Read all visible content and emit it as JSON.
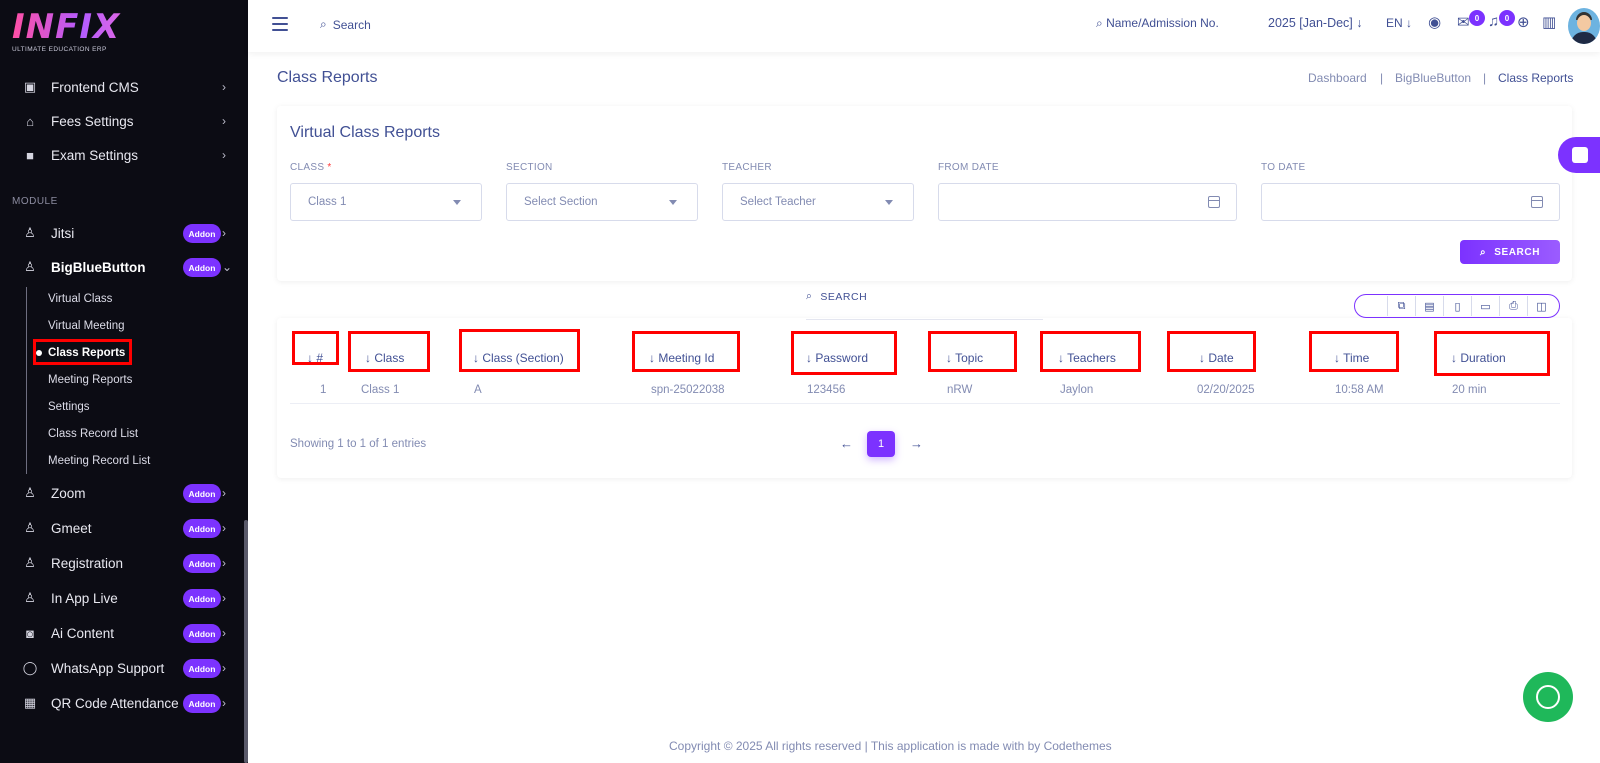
{
  "sidebar": {
    "logo": "INFIX",
    "logo_sub": "ULTIMATE EDUCATION ERP",
    "top_items": [
      {
        "label": "Frontend CMS",
        "icon": "monitor-icon"
      },
      {
        "label": "Fees Settings",
        "icon": "bank-icon"
      },
      {
        "label": "Exam Settings",
        "icon": "book-icon"
      }
    ],
    "section_label": "MODULE",
    "badge": "Addon",
    "modules": [
      {
        "label": "Jitsi"
      },
      {
        "label": "BigBlueButton"
      },
      {
        "label": "Zoom"
      },
      {
        "label": "Gmeet"
      },
      {
        "label": "Registration"
      },
      {
        "label": "In App Live"
      },
      {
        "label": "Ai Content"
      },
      {
        "label": "WhatsApp Support"
      },
      {
        "label": "QR Code Attendance"
      }
    ],
    "sub_items": [
      "Virtual Class",
      "Virtual Meeting",
      "Class Reports",
      "Meeting Reports",
      "Settings",
      "Class Record List",
      "Meeting Record List"
    ]
  },
  "topbar": {
    "search_label": "Search",
    "name_search": "Name/Admission No.",
    "session": "2025 [Jan-Dec]",
    "language": "EN",
    "messages_count": "0",
    "notifications_count": "0"
  },
  "page": {
    "title": "Class Reports",
    "breadcrumb": [
      "Dashboard",
      "BigBlueButton",
      "Class Reports"
    ],
    "card_title": "Virtual Class Reports"
  },
  "filters": {
    "class_label": "CLASS",
    "required_mark": "*",
    "class_value": "Class 1",
    "section_label": "SECTION",
    "section_placeholder": "Select Section",
    "teacher_label": "TEACHER",
    "teacher_placeholder": "Select Teacher",
    "from_label": "FROM DATE",
    "to_label": "TO DATE",
    "search_button": "SEARCH"
  },
  "table": {
    "search_label": "SEARCH",
    "columns": [
      "#",
      "Class",
      "Class (Section)",
      "Meeting Id",
      "Password",
      "Topic",
      "Teachers",
      "Date",
      "Time",
      "Duration"
    ],
    "rows": [
      [
        "1",
        "Class 1",
        "A",
        "spn-25022038",
        "123456",
        "nRW",
        "Jaylon",
        "02/20/2025",
        "10:58 AM",
        "20 min"
      ]
    ],
    "showing": "Showing 1 to 1 of 1 entries",
    "current_page": "1"
  },
  "footer": "Copyright © 2025 All rights reserved | This application is made with by Codethemes",
  "colors": {
    "accent": "#7c32ff",
    "text": "#415094",
    "muted": "#828bb2",
    "sidebar": "#0c0c14",
    "highlight": "#ff0000"
  }
}
